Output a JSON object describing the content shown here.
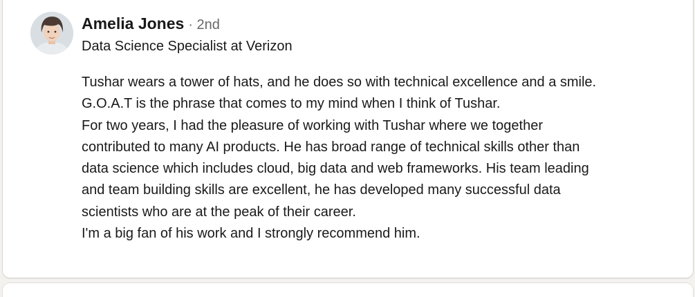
{
  "recommendation": {
    "author": {
      "name": "Amelia Jones",
      "degree": "· 2nd",
      "headline": "Data Science Specialist at Verizon",
      "avatar_icon": "profile-photo"
    },
    "lines": [
      "Tushar wears a tower of hats, and he does so with technical excellence and a smile.",
      "G.O.A.T is the phrase that comes to my mind when I think of Tushar.",
      "For two years, I had the pleasure of working with Tushar where we together",
      "contributed to many AI products. He has broad range of technical skills other than",
      "data science which includes cloud, big data and web frameworks. His team leading",
      "and team building skills are excellent, he has developed many successful data",
      "scientists who are at the peak of their career.",
      "I'm a big fan of his work and I strongly recommend him."
    ]
  },
  "colors": {
    "page_background": "#f4f2ee",
    "card_background": "#ffffff",
    "text_primary": "#1a1a1a",
    "text_secondary": "#666666"
  }
}
